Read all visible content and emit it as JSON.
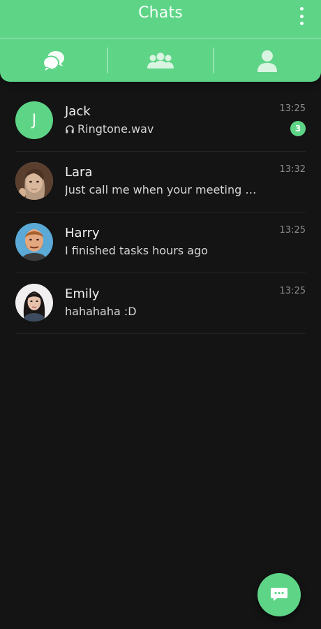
{
  "header": {
    "title": "Chats",
    "menu_icon": "kebab-menu-icon"
  },
  "tabs": [
    {
      "name": "chats",
      "icon": "chat-bubbles-icon",
      "active": true
    },
    {
      "name": "groups",
      "icon": "group-icon",
      "active": false
    },
    {
      "name": "contacts",
      "icon": "person-icon",
      "active": false
    }
  ],
  "chats": [
    {
      "name": "Jack",
      "avatar_letter": "J",
      "preview_icon": "headphones-icon",
      "preview": "Ringtone.wav",
      "time": "13:25",
      "unread": "3"
    },
    {
      "name": "Lara",
      "avatar": "photo",
      "preview": "Just call me when your meeting fin...",
      "time": "13:32"
    },
    {
      "name": "Harry",
      "avatar": "photo",
      "preview": "I finished tasks hours ago",
      "time": "13:25"
    },
    {
      "name": "Emily",
      "avatar": "photo",
      "preview": "hahahaha :D",
      "time": "13:25"
    }
  ],
  "fab": {
    "icon": "new-message-icon"
  },
  "colors": {
    "accent": "#5ed487",
    "background": "#141414"
  }
}
